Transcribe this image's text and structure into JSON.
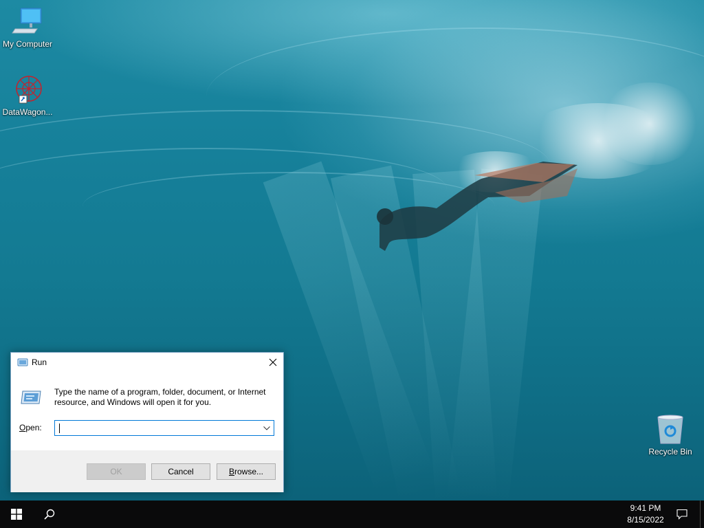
{
  "desktop": {
    "icons": [
      {
        "label": "My Computer",
        "icon": "computer-icon"
      },
      {
        "label": "DataWagon...",
        "icon": "datawagon-app-icon"
      },
      {
        "label": "Recycle Bin",
        "icon": "recycle-bin-icon"
      }
    ]
  },
  "run_dialog": {
    "title": "Run",
    "description": "Type the name of a program, folder, document, or Internet resource, and Windows will open it for you.",
    "open_label_prefix": "",
    "open_label_underline": "O",
    "open_label_rest": "pen:",
    "open_value": "",
    "ok_label": "OK",
    "cancel_label": "Cancel",
    "browse_label_underline": "B",
    "browse_label_rest": "rowse..."
  },
  "taskbar": {
    "time": "9:41 PM",
    "date": "8/15/2022"
  },
  "colors": {
    "accent": "#0078d7",
    "taskbar": "#0a0a0b"
  }
}
